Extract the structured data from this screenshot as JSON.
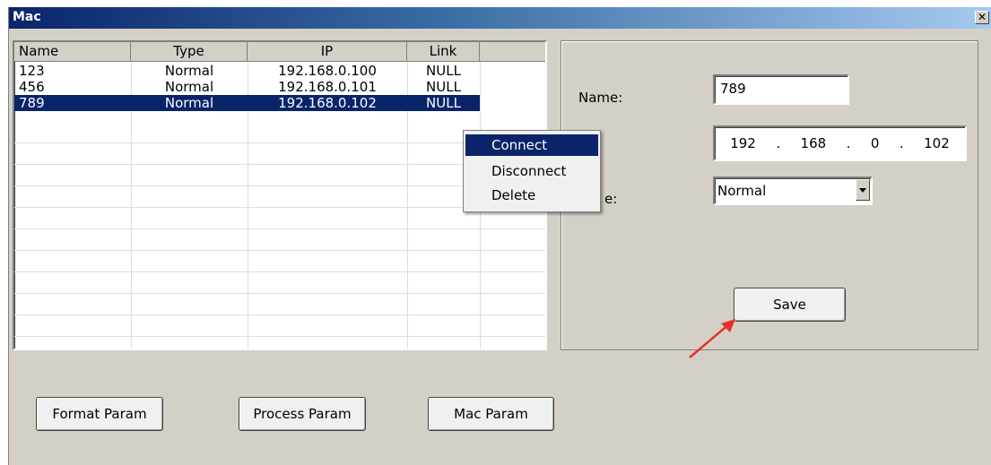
{
  "window": {
    "title": "Mac",
    "close_glyph": "✕"
  },
  "list": {
    "columns": [
      "Name",
      "Type",
      "IP",
      "Link",
      ""
    ],
    "rows": [
      {
        "name": "123",
        "type": "Normal",
        "ip": "192.168.0.100",
        "link": "NULL",
        "selected": false
      },
      {
        "name": "456",
        "type": "Normal",
        "ip": "192.168.0.101",
        "link": "NULL",
        "selected": false
      },
      {
        "name": "789",
        "type": "Normal",
        "ip": "192.168.0.102",
        "link": "NULL",
        "selected": true
      }
    ]
  },
  "context_menu": {
    "items": [
      "Connect",
      "Disconnect",
      "Delete"
    ],
    "highlighted": "Connect"
  },
  "details": {
    "name_label": "Name:",
    "name_value": "789",
    "ip_octets": [
      "192",
      "168",
      "0",
      "102"
    ],
    "ip_separator": ".",
    "type_label_visible": "e:",
    "type_value": "Normal",
    "save_label": "Save"
  },
  "buttons": {
    "format": "Format Param",
    "process": "Process Param",
    "mac": "Mac Param"
  },
  "colors": {
    "selection": "#0a246a",
    "dialog_bg": "#d4d0c8",
    "annotation_arrow": "#e8302a"
  }
}
